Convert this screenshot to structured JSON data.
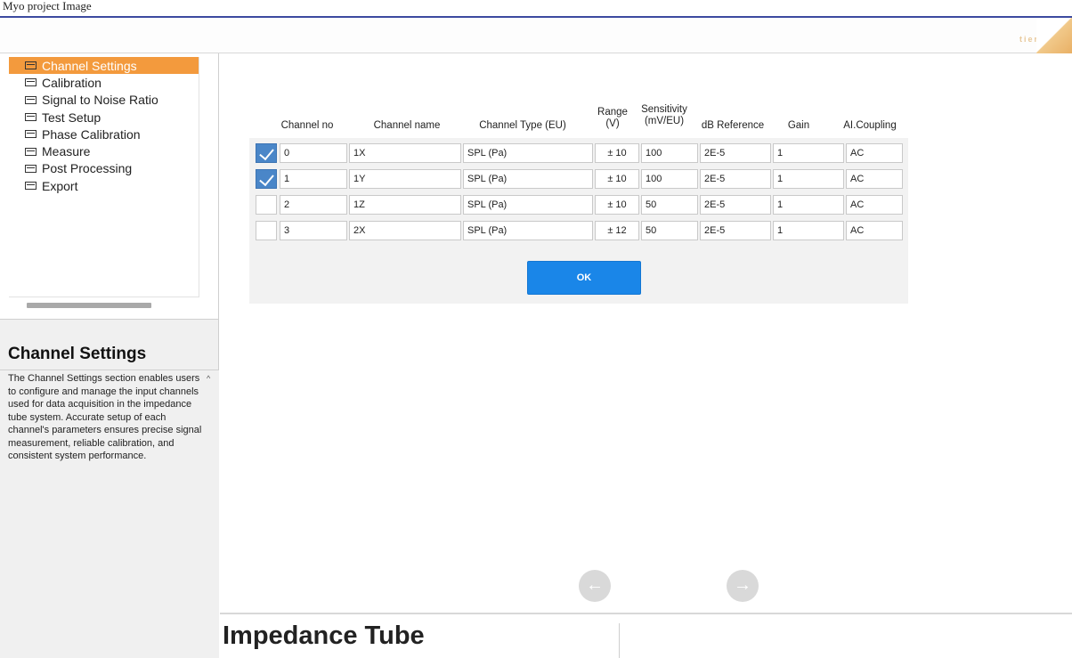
{
  "window": {
    "title": "Myo project Image"
  },
  "brand": {
    "text": "tiera"
  },
  "nav": {
    "items": [
      {
        "label": "Channel Settings",
        "active": true
      },
      {
        "label": "Calibration",
        "active": false
      },
      {
        "label": "Signal to Noise Ratio",
        "active": false
      },
      {
        "label": "Test Setup",
        "active": false
      },
      {
        "label": "Phase Calibration",
        "active": false
      },
      {
        "label": "Measure",
        "active": false
      },
      {
        "label": "Post Processing",
        "active": false
      },
      {
        "label": "Export",
        "active": false
      }
    ]
  },
  "help": {
    "title": "Channel Settings",
    "text": "The Channel Settings section enables users to configure and manage the input channels used for data acquisition in the impedance tube system. Accurate setup of each channel's parameters ensures precise signal measurement, reliable calibration, and consistent system performance."
  },
  "table": {
    "headers": {
      "channel_no": "Channel no",
      "channel_name": "Channel name",
      "channel_type": "Channel Type (EU)",
      "range_1": "Range",
      "range_2": "(V)",
      "sensitivity_1": "Sensitivity",
      "sensitivity_2": "(mV/EU)",
      "db_reference": "dB Reference",
      "gain": "Gain",
      "coupling": "AI.Coupling"
    },
    "rows": [
      {
        "checked": true,
        "no": "0",
        "name": "1X",
        "type": "SPL (Pa)",
        "range": "± 10",
        "sensitivity": "100",
        "db_ref": "2E-5",
        "gain": "1",
        "coupling": "AC"
      },
      {
        "checked": true,
        "no": "1",
        "name": "1Y",
        "type": "SPL (Pa)",
        "range": "± 10",
        "sensitivity": "100",
        "db_ref": "2E-5",
        "gain": "1",
        "coupling": "AC"
      },
      {
        "checked": false,
        "no": "2",
        "name": "1Z",
        "type": "SPL (Pa)",
        "range": "± 10",
        "sensitivity": "50",
        "db_ref": "2E-5",
        "gain": "1",
        "coupling": "AC"
      },
      {
        "checked": false,
        "no": "3",
        "name": "2X",
        "type": "SPL (Pa)",
        "range": "± 12",
        "sensitivity": "50",
        "db_ref": "2E-5",
        "gain": "1",
        "coupling": "AC"
      }
    ]
  },
  "ok_button": {
    "label": "OK"
  },
  "navigation": {
    "back_glyph": "←",
    "next_glyph": "→"
  },
  "footer": {
    "title": "Impedance Tube"
  },
  "colors": {
    "accent": "#f39a3d",
    "primary": "#1a86e8",
    "checked": "#4a86c8"
  }
}
